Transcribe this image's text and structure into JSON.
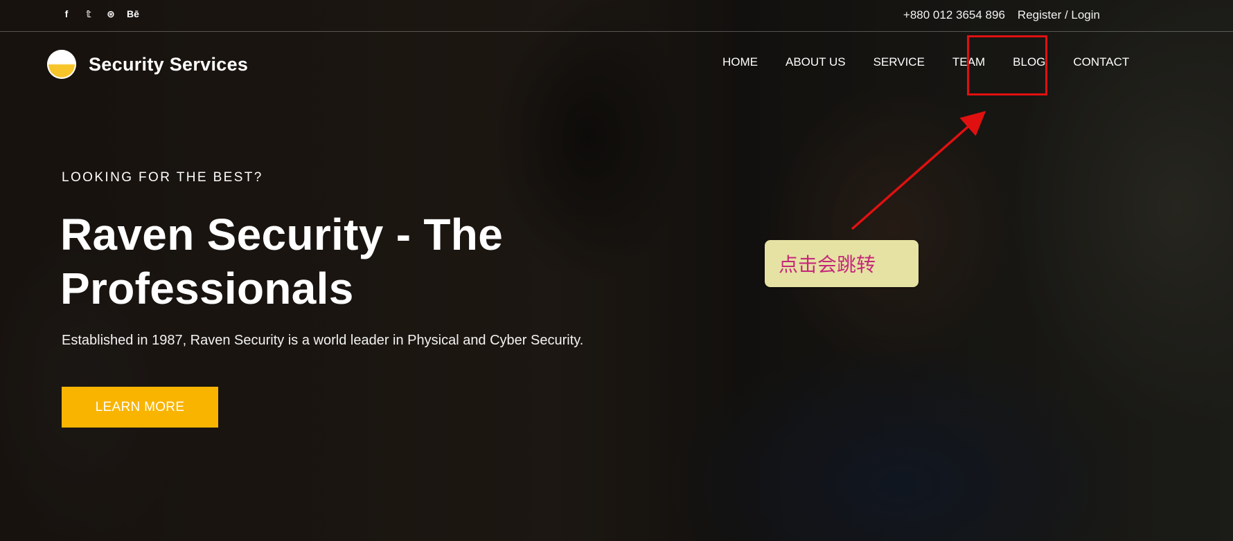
{
  "topbar": {
    "social_icons": [
      "facebook-icon",
      "twitter-icon",
      "dribbble-icon",
      "behance-icon"
    ],
    "social_glyphs": [
      "f",
      "𝕥",
      "⊛",
      "Bē"
    ],
    "phone": "+880 012 3654 896",
    "auth": "Register / Login"
  },
  "header": {
    "brand": "Security Services",
    "nav": [
      "HOME",
      "ABOUT US",
      "SERVICE",
      "TEAM",
      "BLOG",
      "CONTACT"
    ],
    "highlighted_nav": "BLOG"
  },
  "annotation": {
    "tooltip": "点击会跳转",
    "highlight_color": "#e01010",
    "tooltip_color": "#c4287a"
  },
  "hero": {
    "eyebrow": "LOOKING FOR THE BEST?",
    "title_line1": "Raven Security - The",
    "title_line2": "Professionals",
    "subtitle": "Established in 1987, Raven Security is a world leader in Physical and Cyber Security.",
    "cta": "LEARN MORE",
    "cta_color": "#f9b400"
  }
}
